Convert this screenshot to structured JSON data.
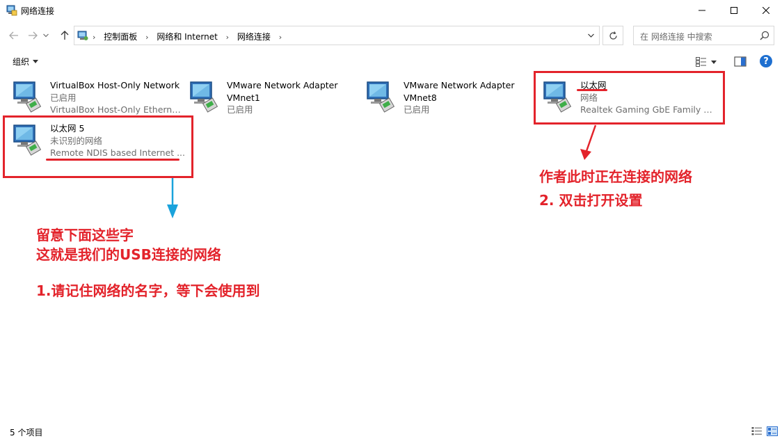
{
  "window": {
    "title": "网络连接",
    "minimize_icon": "minimize-icon",
    "maximize_icon": "maximize-icon",
    "close_icon": "close-icon"
  },
  "address": {
    "crumbs": [
      "控制面板",
      "网络和 Internet",
      "网络连接"
    ],
    "search_placeholder": "在 网络连接 中搜索"
  },
  "toolbar": {
    "organize_label": "组织"
  },
  "connections": [
    {
      "name": "VirtualBox Host-Only Network",
      "status": "已启用",
      "device": "VirtualBox Host-Only Ethernet ..."
    },
    {
      "name": "VMware Network Adapter",
      "status": "VMnet1",
      "device": "已启用"
    },
    {
      "name": "VMware Network Adapter",
      "status": "VMnet8",
      "device": "已启用"
    },
    {
      "name": "以太网",
      "status": "网络",
      "device": "Realtek Gaming GbE Family C..."
    },
    {
      "name": "以太网 5",
      "status": "未识别的网络",
      "device": "Remote NDIS based Internet ..."
    }
  ],
  "annotations": {
    "right_line1": "作者此时正在连接的网络",
    "right_line2": "2. 双击打开设置",
    "left_line1": "留意下面这些字",
    "left_line2": "这就是我们的USB连接的网络",
    "left_line3": "1.请记住网络的名字，等下会使用到",
    "red_color": "#e3232b",
    "blue_color": "#1aa3dc"
  },
  "status": {
    "count": "5 个项目"
  }
}
